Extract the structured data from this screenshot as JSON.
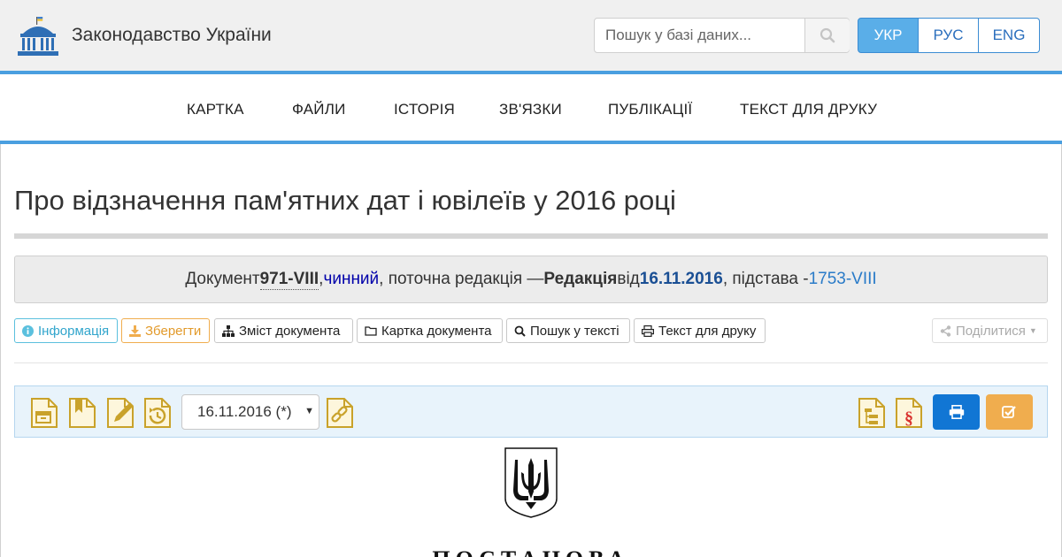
{
  "header": {
    "site_title": "Законодавство України",
    "logo_icon": "parliament-building-icon",
    "search": {
      "placeholder": "Пошук у базі даних...",
      "value": "",
      "button_icon": "search-icon"
    },
    "languages": [
      {
        "label": "УКР",
        "active": true
      },
      {
        "label": "РУС",
        "active": false
      },
      {
        "label": "ENG",
        "active": false
      }
    ]
  },
  "nav": {
    "items": [
      {
        "label": "КАРТКА"
      },
      {
        "label": "ФАЙЛИ"
      },
      {
        "label": "ІСТОРІЯ"
      },
      {
        "label": "ЗВ'ЯЗКИ"
      },
      {
        "label": "ПУБЛІКАЦІЇ"
      },
      {
        "label": "ТЕКСТ ДЛЯ ДРУКУ"
      }
    ]
  },
  "document": {
    "title": "Про відзначення пам'ятних дат і ювілеїв у 2016 році",
    "status": {
      "prefix": "Документ ",
      "number": "971-VIII",
      "sep1": ", ",
      "state": "чинний",
      "middle": ", поточна редакція — ",
      "edition_label": "Редакція",
      "from": " від ",
      "date": "16.11.2016",
      "basis_text": ", підстава - ",
      "basis": "1753-VIII"
    },
    "heading": "ПОСТАНОВА"
  },
  "toolbar": {
    "info_label": "Інформація",
    "save_label": "Зберегти",
    "contents_label": "Зміст документа",
    "card_label": "Картка документа",
    "search_label": "Пошук у тексті",
    "print_label": "Текст для друку",
    "share_label": "Поділитися"
  },
  "doc_toolbar": {
    "selected_date": "16.11.2016 (*)",
    "icons": [
      "archive-doc-icon",
      "bookmark-doc-icon",
      "edit-doc-icon",
      "history-doc-icon",
      "link-doc-icon",
      "structure-doc-icon",
      "section-doc-icon",
      "print-icon",
      "check-square-icon"
    ]
  },
  "colors": {
    "accent_blue": "#4a9fe0",
    "active_lang": "#5aaee8",
    "print_button": "#1176d4",
    "check_button": "#f0ad4e",
    "icon_gold": "#c9a22a"
  }
}
